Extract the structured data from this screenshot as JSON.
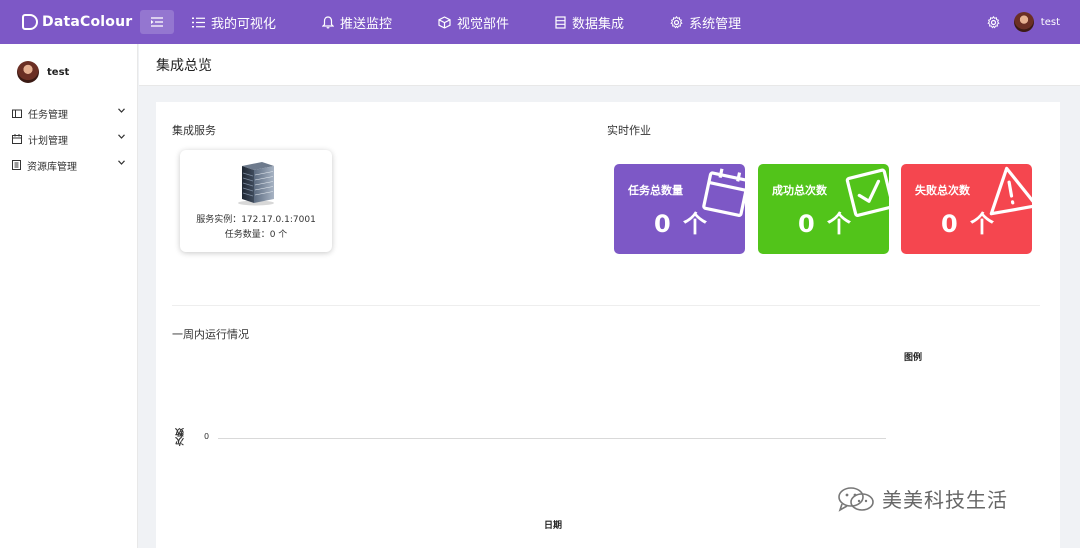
{
  "app": {
    "name": "DataColour"
  },
  "nav": {
    "items": [
      {
        "label": "我的可视化",
        "icon": "list-icon"
      },
      {
        "label": "推送监控",
        "icon": "bell-icon"
      },
      {
        "label": "视觉部件",
        "icon": "cube-icon"
      },
      {
        "label": "数据集成",
        "icon": "database-icon"
      },
      {
        "label": "系统管理",
        "icon": "gear-icon"
      }
    ]
  },
  "user": {
    "name": "test"
  },
  "sidebar": {
    "items": [
      {
        "label": "任务管理",
        "icon": "task-icon"
      },
      {
        "label": "计划管理",
        "icon": "calendar-icon"
      },
      {
        "label": "资源库管理",
        "icon": "library-icon"
      }
    ]
  },
  "page": {
    "title": "集成总览"
  },
  "integration": {
    "title": "集成服务",
    "instance_line": "服务实例：172.17.0.1:7001",
    "task_line": "任务数量：0 个"
  },
  "realtime": {
    "title": "实时作业",
    "cards": [
      {
        "label": "任务总数量",
        "value": "0 个",
        "color": "#7d58c6"
      },
      {
        "label": "成功总次数",
        "value": "0 个",
        "color": "#52c41a"
      },
      {
        "label": "失败总次数",
        "value": "0 个",
        "color": "#f5464f"
      }
    ]
  },
  "weekly": {
    "title": "一周内运行情况",
    "legend_title": "图例",
    "ylabel": "次数",
    "ytick": "0",
    "xlabel": "日期"
  },
  "watermark": {
    "text": "美美科技生活"
  },
  "colors": {
    "brand": "#7d58c6",
    "success": "#52c41a",
    "danger": "#f5464f"
  }
}
